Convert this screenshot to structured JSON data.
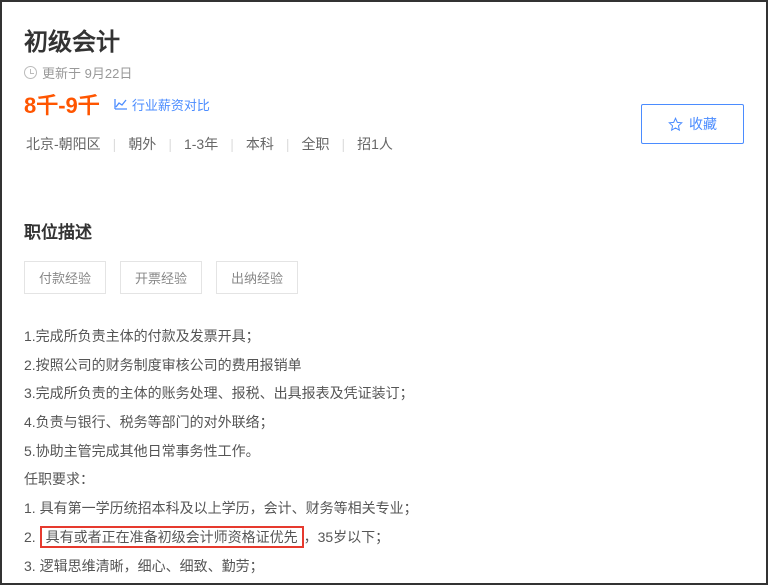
{
  "job": {
    "title": "初级会计",
    "update_prefix": "更新于",
    "update_date": "9月22日",
    "salary": "8千-9千",
    "compare_label": "行业薪资对比"
  },
  "meta": {
    "location": "北京-朝阳区",
    "area": "朝外",
    "experience": "1-3年",
    "education": "本科",
    "jobtype": "全职",
    "headcount": "招1人"
  },
  "favorite_label": "收藏",
  "section": {
    "desc_title": "职位描述"
  },
  "tags": [
    "付款经验",
    "开票经验",
    "出纳经验"
  ],
  "desc": [
    "1.完成所负责主体的付款及发票开具；",
    "2.按照公司的财务制度审核公司的费用报销单",
    "3.完成所负责的主体的账务处理、报税、出具报表及凭证装订；",
    "4.负责与银行、税务等部门的对外联络；",
    "5.协助主管完成其他日常事务性工作。"
  ],
  "req_title": "任职要求：",
  "req": [
    {
      "prefix": "1. ",
      "text": "具有第一学历统招本科及以上学历，会计、财务等相关专业；",
      "highlight": false
    },
    {
      "prefix": "2. ",
      "highlight_text": "具有或者正在准备初级会计师资格证优先",
      "suffix": "，35岁以下；",
      "highlight": true
    },
    {
      "prefix": "3. ",
      "text": "逻辑思维清晰，细心、细致、勤劳；",
      "highlight": false
    }
  ]
}
